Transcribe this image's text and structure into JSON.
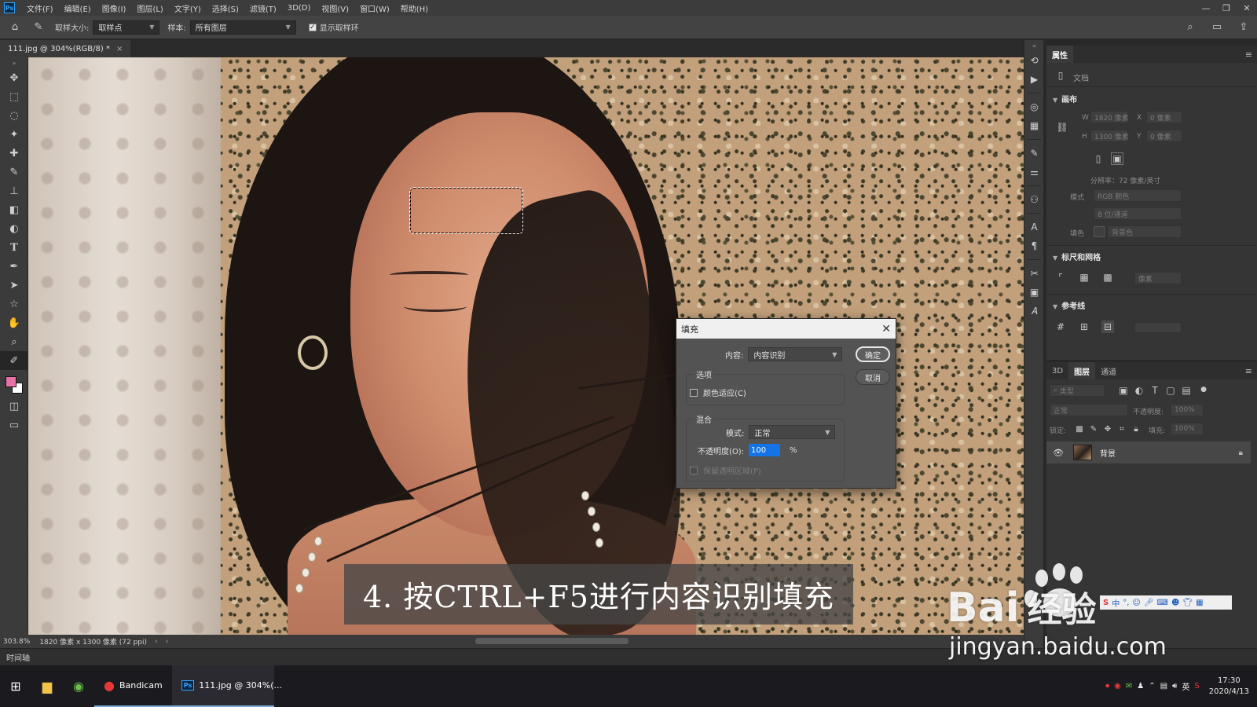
{
  "menubar": {
    "app_logo": "Ps",
    "items": [
      "文件(F)",
      "编辑(E)",
      "图像(I)",
      "图层(L)",
      "文字(Y)",
      "选择(S)",
      "滤镜(T)",
      "3D(D)",
      "视图(V)",
      "窗口(W)",
      "帮助(H)"
    ],
    "window_controls": [
      "—",
      "❐",
      "✕"
    ]
  },
  "options_bar": {
    "sample_size_label": "取样大小:",
    "sample_size_value": "取样点",
    "sample_label": "样本:",
    "sample_value": "所有图层",
    "show_ring_label": "显示取样环",
    "show_ring_checked": true
  },
  "document": {
    "tab_title": "111.jpg @ 304%(RGB/8) *"
  },
  "canvas": {
    "subtitle": "4. 按CTRL+F5进行内容识别填充"
  },
  "fill_dialog": {
    "title": "填充",
    "content_label": "内容:",
    "content_value": "内容识别",
    "ok_label": "确定",
    "cancel_label": "取消",
    "options_group": "选项",
    "color_adapt_label": "颜色适应(C)",
    "blend_group": "混合",
    "mode_label": "模式:",
    "mode_value": "正常",
    "opacity_label": "不透明度(O):",
    "opacity_value": "100",
    "opacity_unit": "%",
    "preserve_transparency_label": "保留透明区域(P)"
  },
  "properties": {
    "tab_label": "属性",
    "doc_label": "文档",
    "canvas_section": "画布",
    "w_label": "W",
    "w_value": "1820 像素",
    "h_label": "H",
    "h_value": "1300 像素",
    "x_label": "X",
    "x_value": "0 像素",
    "y_label": "Y",
    "y_value": "0 像素",
    "resolution": "分辨率：72 像素/英寸",
    "mode_label": "模式",
    "mode_value": "RGB 颜色",
    "depth_value": "8 位/通道",
    "fill_label": "填色",
    "fill_value": "背景色",
    "rulers_section": "标尺和网格",
    "units_value": "像素",
    "guides_section": "参考线"
  },
  "layers": {
    "tabs": [
      "3D",
      "图层",
      "通道"
    ],
    "active_tab": "图层",
    "filter_placeholder": "类型",
    "blend_mode": "正常",
    "opacity_label": "不透明度:",
    "opacity_value": "100%",
    "lock_label": "锁定:",
    "fill_label": "填充:",
    "fill_value": "100%",
    "layer_name": "背景"
  },
  "status_bar": {
    "zoom": "303.8%",
    "doc_info": "1820 像素 x 1300 像素 (72 ppi)"
  },
  "timeline": {
    "label": "时间轴"
  },
  "taskbar": {
    "bandicam_label": "Bandicam",
    "photoshop_label": "111.jpg @ 304%(...",
    "lang": "英",
    "time": "17:30",
    "date": "2020/4/13"
  },
  "watermark": {
    "brand": "Bai",
    "brand_cn": "经验",
    "url": "jingyan.baidu.com"
  }
}
